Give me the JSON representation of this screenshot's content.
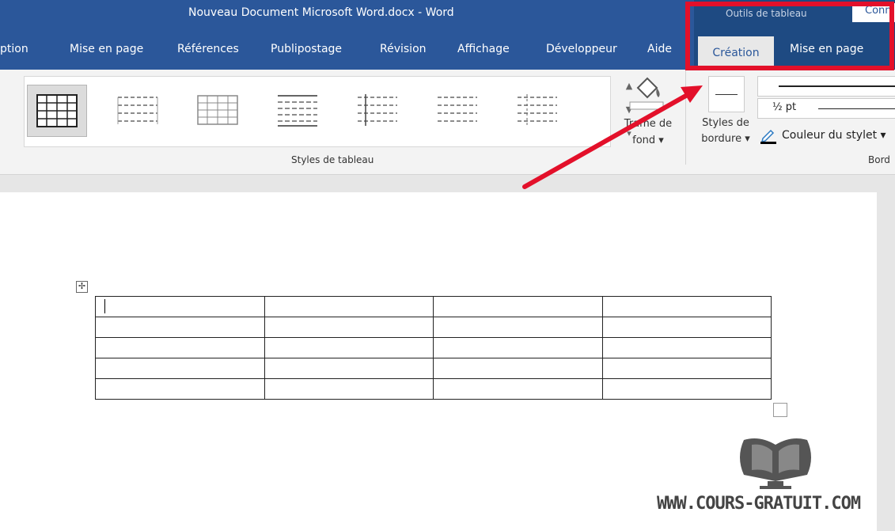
{
  "window": {
    "title": "Nouveau Document Microsoft Word.docx  -  Word"
  },
  "context_group": {
    "label": "Outils de tableau",
    "extra_tab": "Conn"
  },
  "tabs": [
    {
      "label": "ption"
    },
    {
      "label": "Mise en page"
    },
    {
      "label": "Références"
    },
    {
      "label": "Publipostage"
    },
    {
      "label": "Révision"
    },
    {
      "label": "Affichage"
    },
    {
      "label": "Développeur"
    },
    {
      "label": "Aide"
    }
  ],
  "context_tabs": [
    {
      "label": "Création",
      "active": true
    },
    {
      "label": "Mise en page",
      "active": false
    }
  ],
  "ribbon": {
    "styles_group_label": "Styles de tableau",
    "shading_line1": "Trame de",
    "shading_line2": "fond ▾",
    "border_styles_line1": "Styles de",
    "border_styles_line2": "bordure ▾",
    "line_weight": "½ pt",
    "pen_color": "Couleur du stylet ▾",
    "borders_group_label": "Bord"
  },
  "table": {
    "rows": 5,
    "cols": 4
  },
  "watermark": {
    "url": "WWW.COURS-GRATUIT.COM"
  },
  "colors": {
    "word_blue": "#2b579a",
    "context_blue": "#1e4a82",
    "highlight_red": "#e3102a",
    "ribbon_bg": "#f3f3f3"
  }
}
